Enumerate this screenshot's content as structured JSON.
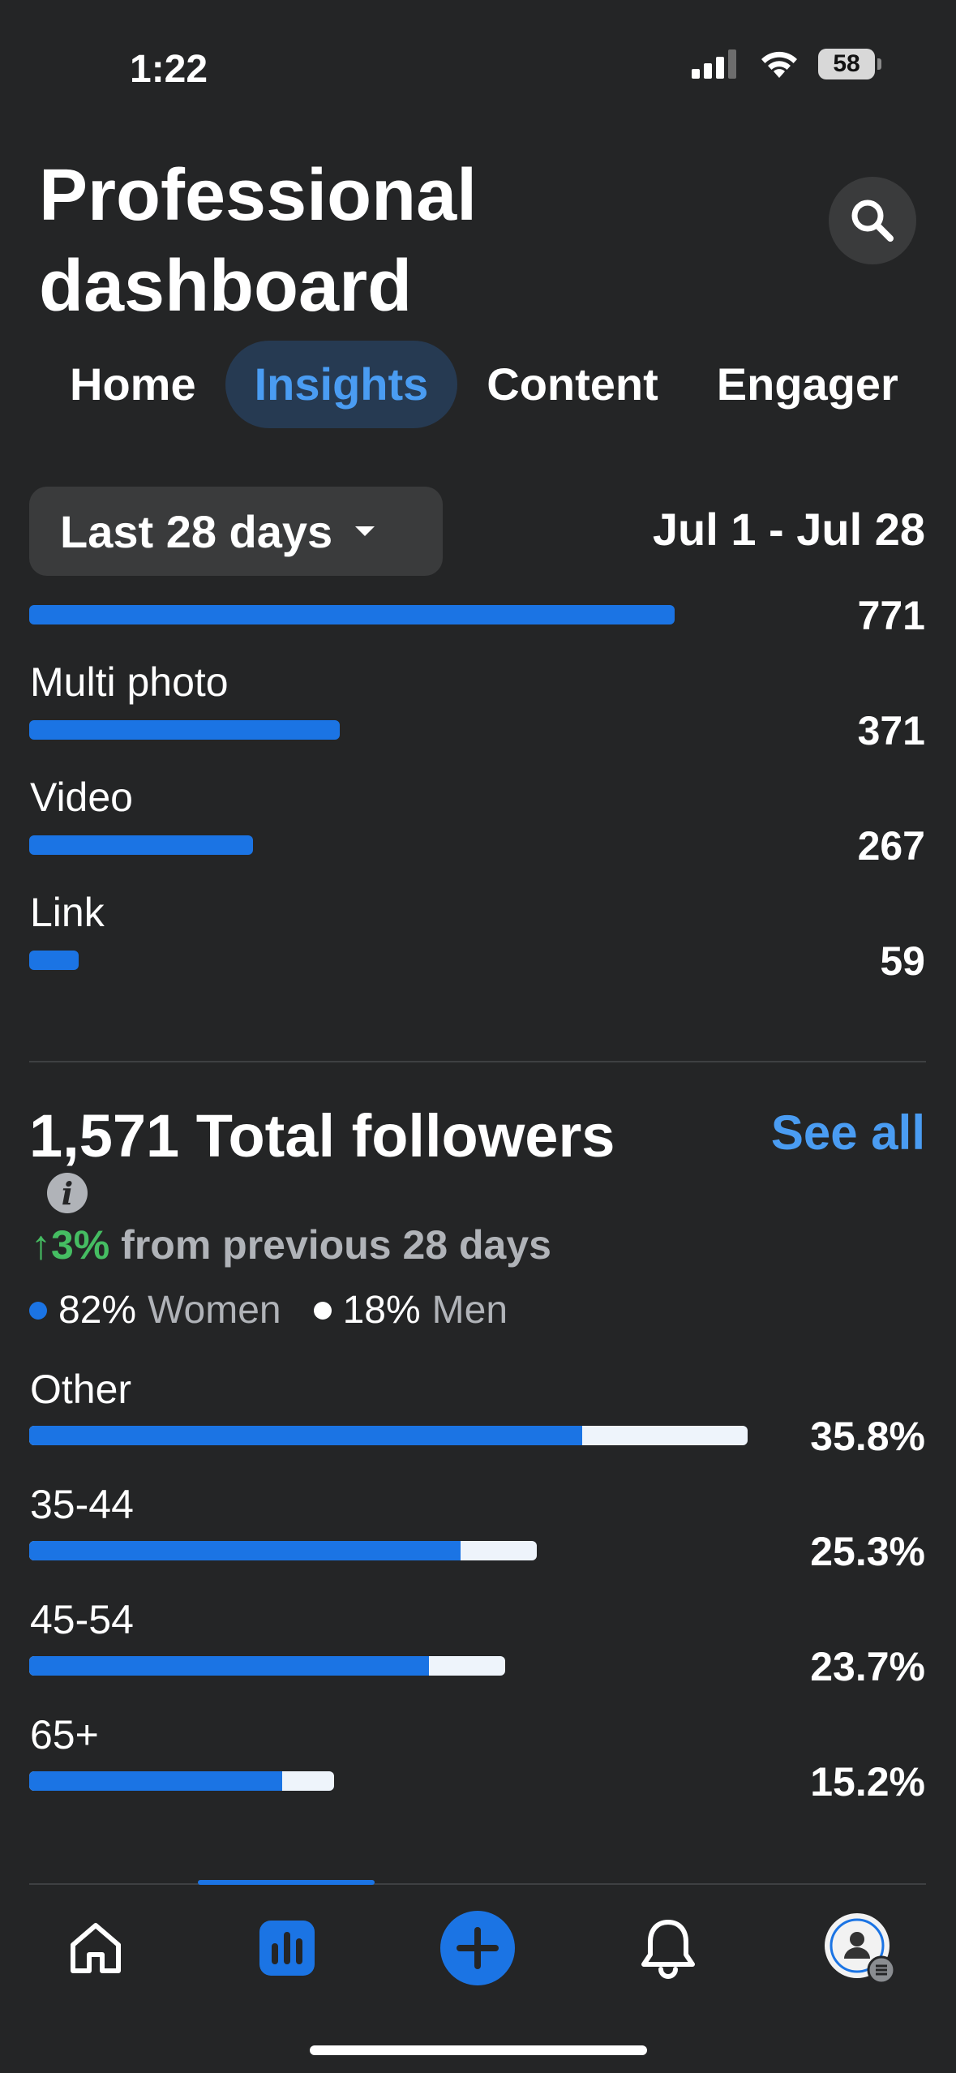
{
  "status_bar": {
    "time": "1:22",
    "battery": "58"
  },
  "header": {
    "title": "Professional dashboard"
  },
  "tabs": [
    {
      "label": "Home",
      "active": false
    },
    {
      "label": "Insights",
      "active": true
    },
    {
      "label": "Content",
      "active": false
    },
    {
      "label": "Engager",
      "active": false
    }
  ],
  "filter": {
    "selected": "Last 28 days",
    "date_range": "Jul 1 - Jul 28"
  },
  "content_types": {
    "top_value": "771",
    "items": [
      {
        "label": "Multi photo",
        "value": "371"
      },
      {
        "label": "Video",
        "value": "267"
      },
      {
        "label": "Link",
        "value": "59"
      }
    ],
    "bar_values": [
      771,
      371,
      267,
      59
    ],
    "max": 771
  },
  "followers": {
    "title": "1,571 Total followers",
    "see_all": "See all",
    "change_arrow": "↑",
    "change_pct": "3%",
    "change_text": "from previous 28 days",
    "women_pct": "82%",
    "women_label": "Women",
    "men_pct": "18%",
    "men_label": "Men",
    "women_color": "#1b74e4",
    "men_color": "#eef4fb"
  },
  "age_groups": [
    {
      "label": "Other",
      "value": "35.8%",
      "total": 35.8,
      "women_share": 0.77
    },
    {
      "label": "35-44",
      "value": "25.3%",
      "total": 25.3,
      "women_share": 0.85
    },
    {
      "label": "45-54",
      "value": "23.7%",
      "total": 23.7,
      "women_share": 0.84
    },
    {
      "label": "65+",
      "value": "15.2%",
      "total": 15.2,
      "women_share": 0.83
    }
  ],
  "nav": {
    "items": [
      "home-icon",
      "insights-icon",
      "create-icon",
      "notifications-icon",
      "profile-avatar"
    ],
    "active": "insights-icon"
  }
}
